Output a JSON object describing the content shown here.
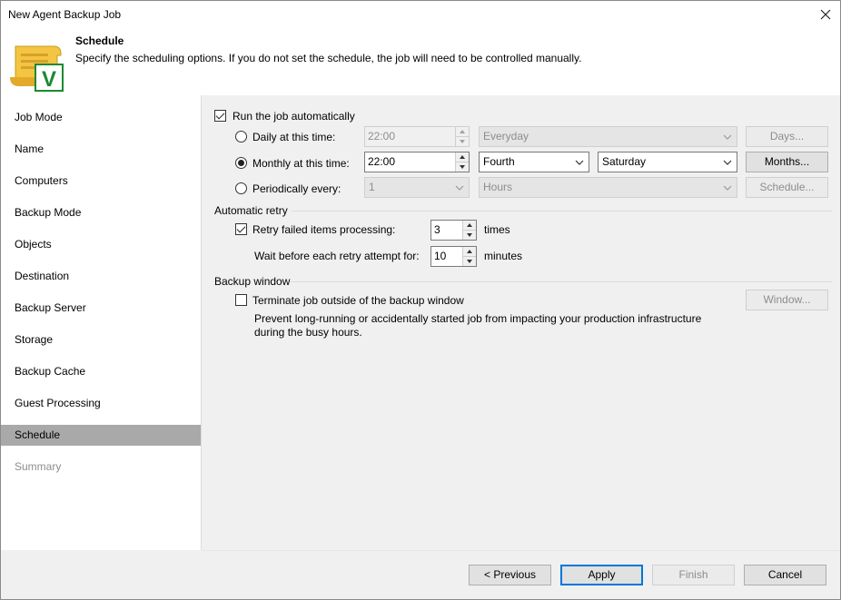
{
  "window": {
    "title": "New Agent Backup Job",
    "close_glyph": "✕"
  },
  "header": {
    "icon": "scroll-check-icon",
    "icon_letter": "V",
    "title": "Schedule",
    "description": "Specify the scheduling options. If you do not set the schedule, the job will need to be controlled manually."
  },
  "sidebar": {
    "items": [
      {
        "label": "Job Mode"
      },
      {
        "label": "Name"
      },
      {
        "label": "Computers"
      },
      {
        "label": "Backup Mode"
      },
      {
        "label": "Objects"
      },
      {
        "label": "Destination"
      },
      {
        "label": "Backup Server"
      },
      {
        "label": "Storage"
      },
      {
        "label": "Backup Cache"
      },
      {
        "label": "Guest Processing"
      },
      {
        "label": "Schedule"
      },
      {
        "label": "Summary"
      }
    ],
    "active_item": "Schedule"
  },
  "schedule": {
    "run_automatically": {
      "label": "Run the job automatically",
      "checked": true
    },
    "daily": {
      "label": "Daily at this time:",
      "time": "22:00",
      "option": "Everyday",
      "button": "Days..."
    },
    "monthly": {
      "label": "Monthly at this time:",
      "time": "22:00",
      "week": "Fourth",
      "day": "Saturday",
      "button": "Months..."
    },
    "periodically": {
      "label": "Periodically every:",
      "value": "1",
      "unit": "Hours",
      "button": "Schedule..."
    },
    "selected_option": "monthly"
  },
  "retry": {
    "section_title": "Automatic retry",
    "retry_label": "Retry failed items processing:",
    "retry_checked": true,
    "retry_count": "3",
    "retry_unit": "times",
    "wait_label": "Wait before each retry attempt for:",
    "wait_value": "10",
    "wait_unit": "minutes"
  },
  "backup_window": {
    "section_title": "Backup window",
    "terminate_label": "Terminate job outside of the backup window",
    "terminate_checked": false,
    "button": "Window...",
    "description_line1": "Prevent long-running or accidentally started job from impacting your production infrastructure",
    "description_line2": "during the busy hours."
  },
  "footer": {
    "previous": "< Previous",
    "apply": "Apply",
    "finish": "Finish",
    "cancel": "Cancel"
  }
}
